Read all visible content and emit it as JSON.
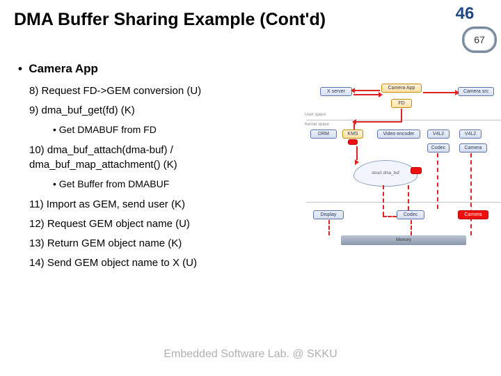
{
  "slide_title": "DMA Buffer Sharing Example (Cont'd)",
  "page_major": "46",
  "page_minor": "67",
  "section": "Camera App",
  "steps": {
    "s8": "8) Request FD->GEM conversion (U)",
    "s9": "9) dma_buf_get(fd) (K)",
    "s9s": "Get DMABUF from FD",
    "s10": "10) dma_buf_attach(dma-buf) / dma_buf_map_attachment() (K)",
    "s10s": "Get Buffer from DMABUF",
    "s11": "11) Import as GEM, send user (K)",
    "s12": "12) Request GEM object name (U)",
    "s13": "13) Return GEM object name (K)",
    "s14": "14) Send GEM object name to X (U)"
  },
  "footer": "Embedded Software Lab. @ SKKU",
  "diagram": {
    "user_label": "User space",
    "kernel_label": "Kernel space",
    "xserver": "X server",
    "camera_app": "Camera App",
    "fd": "FD",
    "camera_src": "Camera src",
    "drm": "DRM",
    "kms": "KMS",
    "video_encoder": "Video encoder",
    "v4l2_a": "V4L2",
    "codec_a": "Codec",
    "v4l2_b": "V4L2",
    "camera_drv": "Camera",
    "struct_dmabuf": "struct dma_buf",
    "display_hw": "Display",
    "codec_hw": "Codec",
    "camera_hw": "Camera",
    "memory": "Memory"
  }
}
